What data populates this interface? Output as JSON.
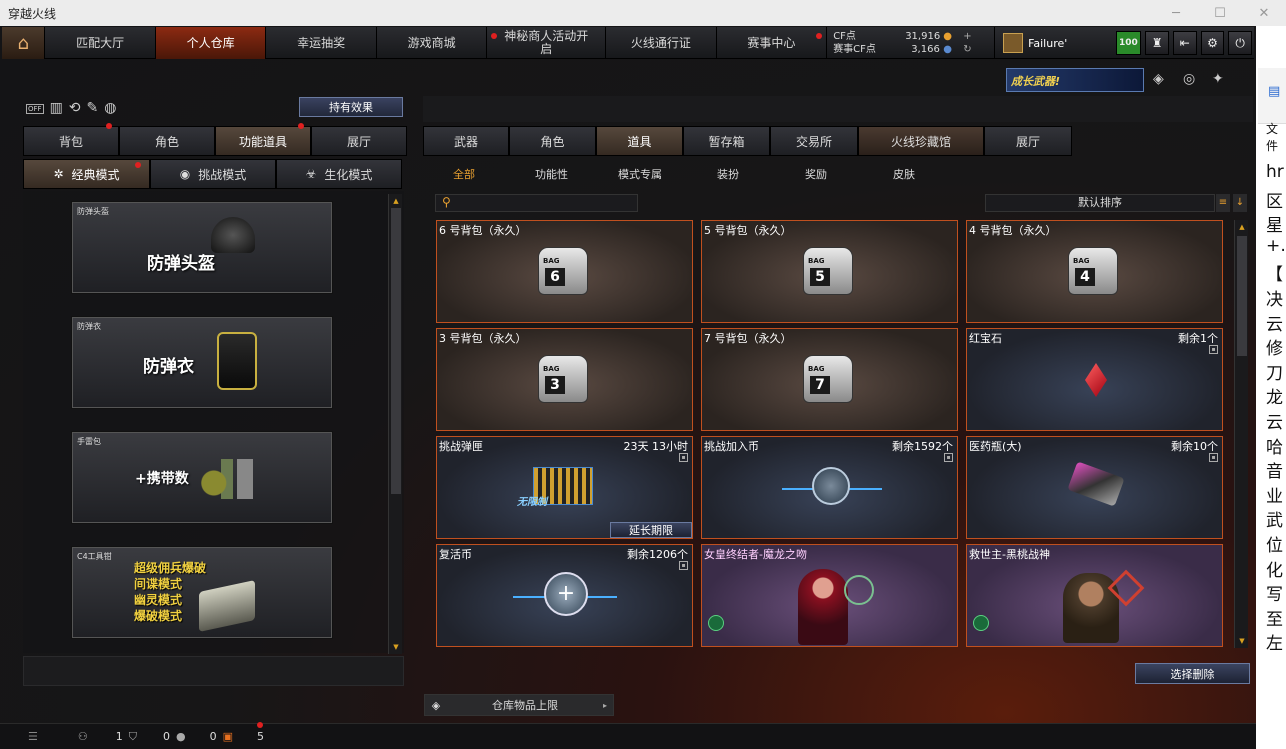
{
  "window": {
    "title": "穿越火线"
  },
  "nav": {
    "tabs": [
      "匹配大厅",
      "个人仓库",
      "幸运抽奖",
      "游戏商城",
      "神秘商人活动开启",
      "火线通行证",
      "赛事中心"
    ],
    "cf_label": "CF点",
    "cf_value": "31,916",
    "scf_label": "赛事CF点",
    "scf_value": "3,166",
    "username": "Failure'",
    "level": "100"
  },
  "banner": {
    "text": "成长武器!"
  },
  "left": {
    "effect_button": "持有效果",
    "off_label": "OFF",
    "tabs": [
      "背包",
      "角色",
      "功能道具",
      "展厅"
    ],
    "modes": [
      "经典模式",
      "挑战模式",
      "生化模式"
    ],
    "cards": [
      {
        "label": "防弹头盔",
        "big": "防弹头盔"
      },
      {
        "label": "防弹衣",
        "big": "防弹衣"
      },
      {
        "label": "手雷包",
        "big": "+携带数"
      },
      {
        "label": "C4工具钳",
        "lines": [
          "超级佣兵爆破",
          "间谍模式",
          "幽灵模式",
          "爆破模式"
        ]
      }
    ]
  },
  "right": {
    "tabs": [
      "武器",
      "角色",
      "道具",
      "暂存箱",
      "交易所",
      "火线珍藏馆",
      "展厅"
    ],
    "subtabs": [
      "全部",
      "功能性",
      "模式专属",
      "装扮",
      "奖励",
      "皮肤"
    ],
    "sort_label": "默认排序",
    "items": [
      {
        "name": "6 号背包（永久）",
        "bag": "6",
        "bag_label": "BAG"
      },
      {
        "name": "5 号背包（永久）",
        "bag": "5",
        "bag_label": "BAG"
      },
      {
        "name": "4 号背包（永久）",
        "bag": "4",
        "bag_label": "BAG"
      },
      {
        "name": "3 号背包（永久）",
        "bag": "3",
        "bag_label": "BAG"
      },
      {
        "name": "7 号背包（永久）",
        "bag": "7",
        "bag_label": "BAG"
      },
      {
        "name": "红宝石",
        "right": "剩余1个"
      },
      {
        "name": "挑战弹匣",
        "right": "23天 13小时",
        "extend": "延长期限",
        "badge": "无限制"
      },
      {
        "name": "挑战加入币",
        "right": "剩余1592个"
      },
      {
        "name": "医药瓶(大)",
        "right": "剩余10个"
      },
      {
        "name": "复活币",
        "right": "剩余1206个"
      },
      {
        "name": "女皇终结者-魔龙之吻"
      },
      {
        "name": "救世主-黑桃战神"
      }
    ],
    "delete_button": "选择删除",
    "storage_limit": "仓库物品上限"
  },
  "status": {
    "count1": "1",
    "count2": "0",
    "count3": "0",
    "count4": "5"
  },
  "side": {
    "top": "文件",
    "chars": [
      "hr",
      "区",
      "星",
      "+…",
      "【",
      "决",
      "云",
      "修",
      "刀",
      "龙",
      "云",
      "哈",
      "音",
      "业",
      "武",
      "位",
      "化",
      "写",
      "至",
      "左"
    ]
  },
  "colors": {
    "accent": "#c0501f",
    "gold": "#e8a030",
    "blue_btn": "#3b4460"
  }
}
